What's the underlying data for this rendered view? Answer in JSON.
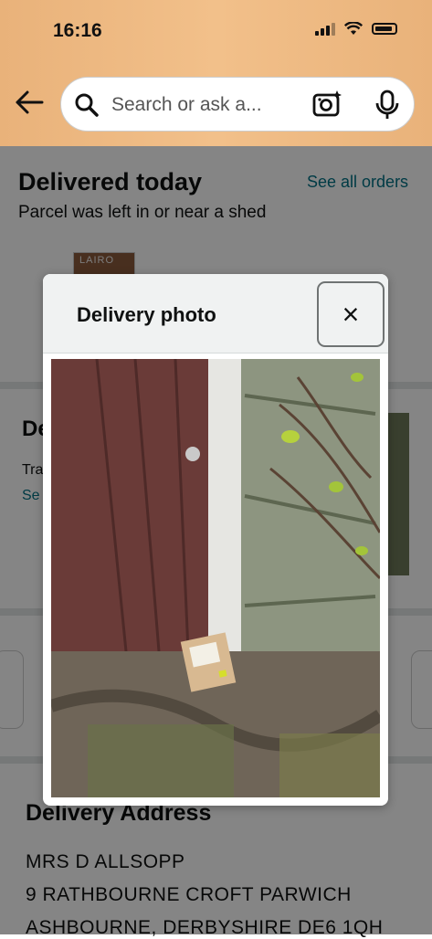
{
  "status_bar": {
    "time": "16:16"
  },
  "header": {
    "search_placeholder": "Search or ask a..."
  },
  "order": {
    "title": "Delivered today",
    "see_all": "See all orders",
    "subtitle": "Parcel was left in or near a shed",
    "thumb_text": "LAIRO"
  },
  "section2": {
    "title_partial": "De",
    "line_partial": "Tra",
    "link_partial": "Se"
  },
  "address": {
    "title": "Delivery Address",
    "lines": [
      "MRS D ALLSOPP",
      "9 RATHBOURNE CROFT PARWICH",
      "ASHBOURNE, DERBYSHIRE DE6 1QH"
    ]
  },
  "modal": {
    "title": "Delivery photo",
    "close_label": "×"
  },
  "colors": {
    "header_bg": "#f2c08a",
    "link": "#007185",
    "text": "#0f1111"
  }
}
